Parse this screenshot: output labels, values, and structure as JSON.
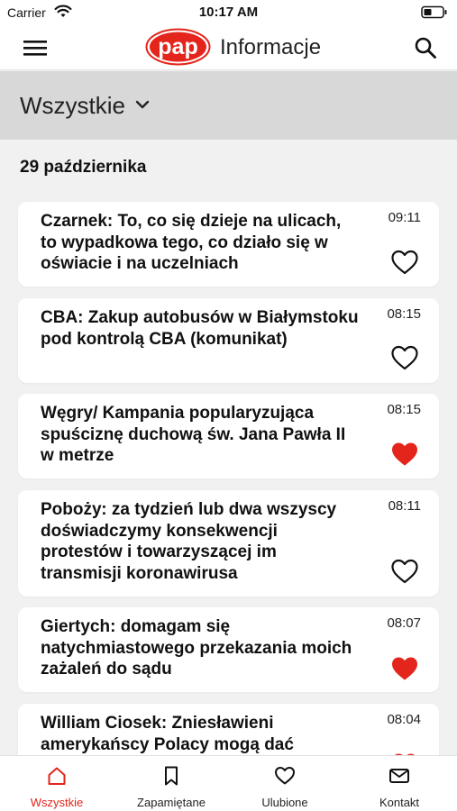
{
  "status_bar": {
    "carrier": "Carrier",
    "time": "10:17 AM"
  },
  "header": {
    "logo_text": "pap",
    "title": "Informacje"
  },
  "filter": {
    "label": "Wszystkie"
  },
  "date_heading": "29 października",
  "articles": [
    {
      "title": "Czarnek: To, co się dzieje na ulicach, to wypadkowa tego, co działo się w oświacie i na uczelniach",
      "time": "09:11",
      "favorite": false
    },
    {
      "title": "CBA: Zakup autobusów w Białymstoku pod kontrolą CBA (komunikat)",
      "time": "08:15",
      "favorite": false
    },
    {
      "title": "Węgry/ Kampania popularyzująca spuściznę duchową św. Jana Pawła II w metrze",
      "time": "08:15",
      "favorite": true
    },
    {
      "title": "Pobożу: za tydzień lub dwa wszyscy doświadczymy konsekwencji protestów i towarzyszącej im transmisji koronawirusa",
      "time": "08:11",
      "favorite": false
    },
    {
      "title": "Giertych: domagam się natychmiastowego przekazania moich zażaleń do sądu",
      "time": "08:07",
      "favorite": true
    },
    {
      "title": "William Ciosek: Zniesławieni amerykańscy Polacy mogą dać",
      "time": "08:04",
      "favorite": true
    }
  ],
  "tabs": [
    {
      "label": "Wszystkie",
      "icon": "home-icon",
      "active": true
    },
    {
      "label": "Zapamiętane",
      "icon": "bookmark-icon",
      "active": false
    },
    {
      "label": "Ulubione",
      "icon": "heart-icon",
      "active": false
    },
    {
      "label": "Kontakt",
      "icon": "mail-icon",
      "active": false
    }
  ],
  "colors": {
    "accent": "#e3251c",
    "filter_bar": "#d8d8d8",
    "background": "#f1f1f1"
  }
}
